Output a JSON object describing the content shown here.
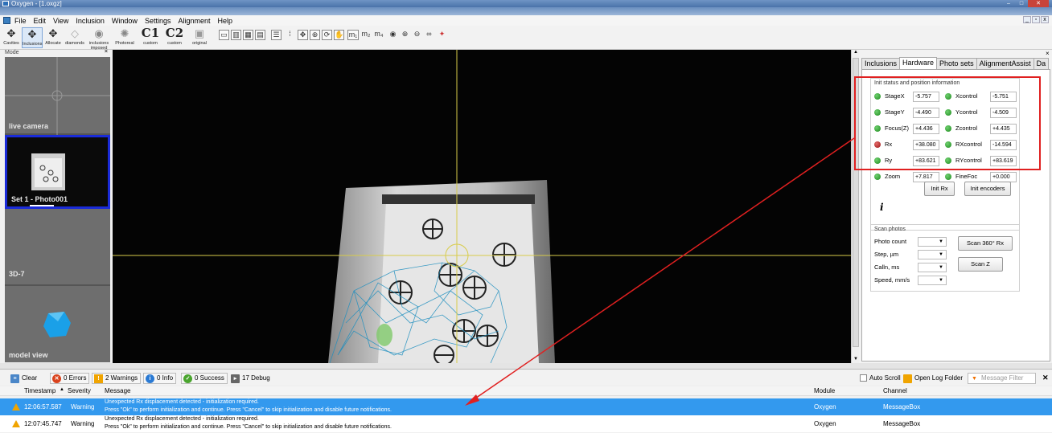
{
  "window": {
    "title": "Oxygen - [1.oxgz]",
    "controls": [
      "–",
      "□",
      "✕"
    ]
  },
  "menu": [
    "File",
    "Edit",
    "View",
    "Inclusion",
    "Window",
    "Settings",
    "Alignment",
    "Help"
  ],
  "toolbar": {
    "cavities": "Cavities",
    "inclusions": "Inclusions",
    "allocate": "Allocate",
    "diamonds": "diamonds",
    "inclusions_imposed": "inclusions imposed",
    "photoreal": "Photoreal",
    "c1": "C1",
    "c1_sub": "custom",
    "c2": "C2",
    "c2_sub": "custom",
    "original": "original"
  },
  "sidebar": {
    "header": "Mode",
    "items": [
      {
        "label": "live camera"
      },
      {
        "label": "Set 1 - Photo001"
      },
      {
        "label": "3D-7"
      },
      {
        "label": "model view"
      }
    ]
  },
  "tabs": [
    "Inclusions",
    "Hardware",
    "Photo sets",
    "AlignmentAssist",
    "Da"
  ],
  "hardware": {
    "init_title": "Init status and position information",
    "rows": [
      {
        "l1": "StageX",
        "v1": "-5.757",
        "s1": "green",
        "l2": "Xcontrol",
        "v2": "-5.751",
        "s2": "green"
      },
      {
        "l1": "StageY",
        "v1": "-4.490",
        "s1": "green",
        "l2": "Ycontrol",
        "v2": "-4.509",
        "s2": "green"
      },
      {
        "l1": "Focus(Z)",
        "v1": "+4.436",
        "s1": "green",
        "l2": "Zcontrol",
        "v2": "+4.435",
        "s2": "green"
      },
      {
        "l1": "Rx",
        "v1": "+38.080",
        "s1": "red",
        "l2": "RXcontrol",
        "v2": "-14.594",
        "s2": "green"
      },
      {
        "l1": "Ry",
        "v1": "+83.621",
        "s1": "green",
        "l2": "RYcontrol",
        "v2": "+83.619",
        "s2": "green"
      },
      {
        "l1": "Zoom",
        "v1": "+7.817",
        "s1": "green",
        "l2": "FineFoc",
        "v2": "+0.000",
        "s2": "green"
      }
    ],
    "init_rx": "Init Rx",
    "init_encoders": "Init encoders",
    "info_icon": "i",
    "scan_title": "Scan photos",
    "scan_fields": [
      "Photo count",
      "Step, µm",
      "Calln, ms",
      "Speed, mm/s"
    ],
    "scan_360": "Scan 360° Rx",
    "scan_z": "Scan Z"
  },
  "log": {
    "clear": "Clear",
    "errors": "0 Errors",
    "warnings": "2 Warnings",
    "info": "0 Info",
    "success": "0 Success",
    "debug": "17 Debug",
    "auto_scroll": "Auto Scroll",
    "open_folder": "Open Log Folder",
    "filter_placeholder": "Message Filter",
    "columns": {
      "timestamp": "Timestamp",
      "severity": "Severity",
      "message": "Message",
      "module": "Module",
      "channel": "Channel"
    },
    "rows": [
      {
        "time": "12:06:57.587",
        "severity": "Warning",
        "line1": "Unexpected Rx displacement detected - initialization required.",
        "line2": "Press \"Ok\" to perform initialization and continue. Press \"Cancel\" to skip initialization and disable future notifications.",
        "module": "Oxygen",
        "channel": "MessageBox"
      },
      {
        "time": "12:07:45.747",
        "severity": "Warning",
        "line1": "Unexpected Rx displacement detected - initialization required.",
        "line2": "Press \"Ok\" to perform initialization and continue. Press \"Cancel\" to skip initialization and disable future notifications.",
        "module": "Oxygen",
        "channel": "MessageBox"
      }
    ]
  },
  "colors": {
    "accent": "#3399ee",
    "highlight": "#e02020",
    "status_ok": "#1d8a1d",
    "status_err": "#9a1212"
  }
}
